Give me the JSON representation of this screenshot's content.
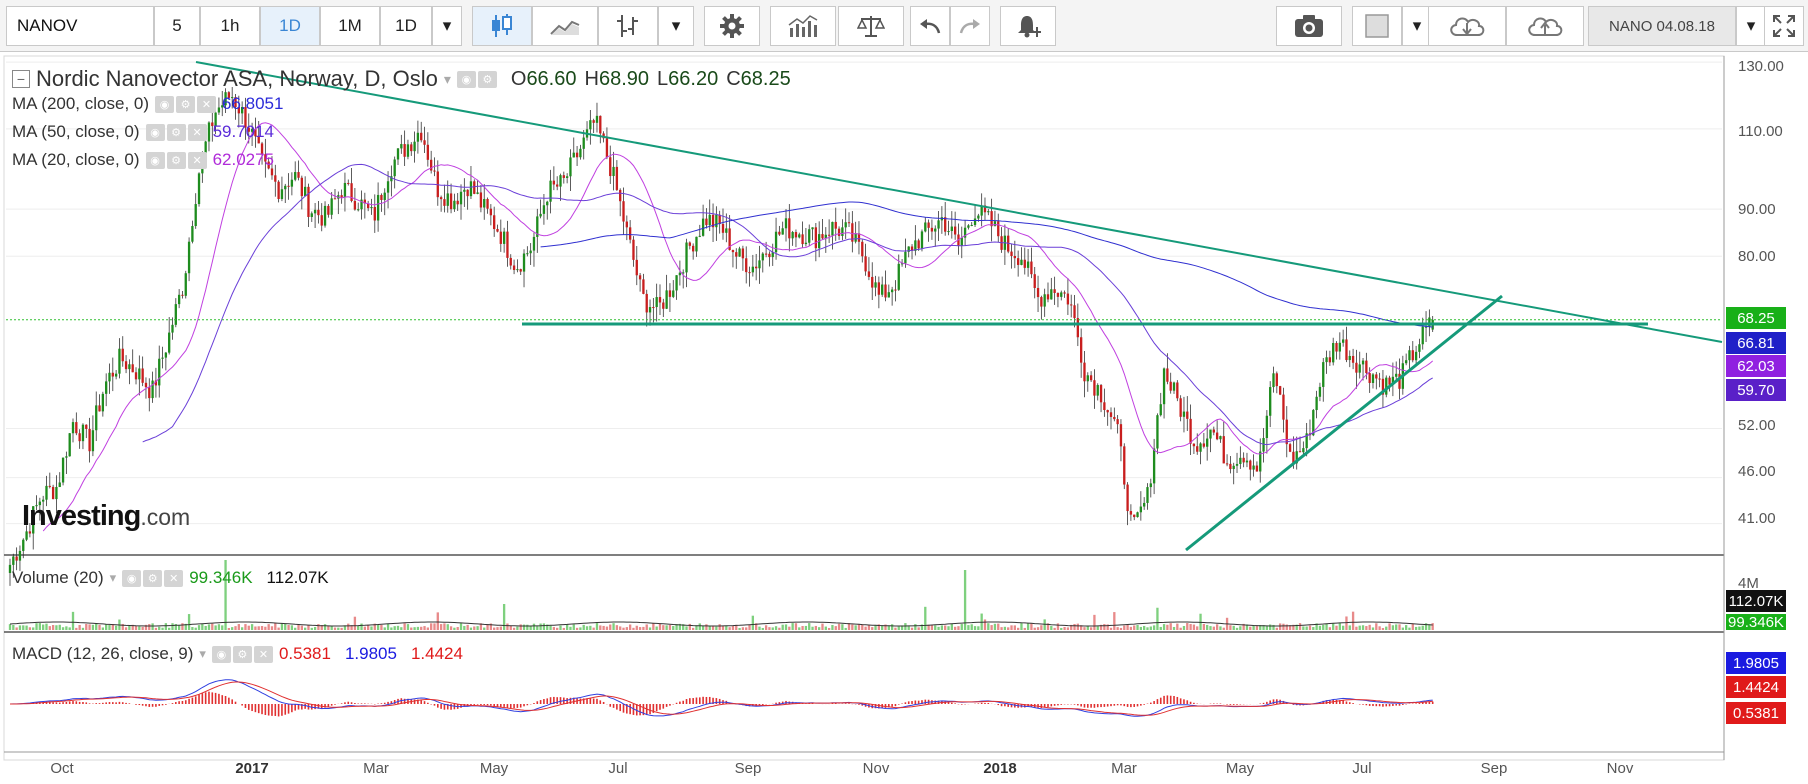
{
  "toolbar": {
    "symbol": "NANOV",
    "intervals": [
      "5",
      "1h",
      "1D",
      "1M",
      "1D"
    ],
    "active_interval": "1D",
    "range_label": "NANO 04.08.18",
    "icons": [
      "candles-icon",
      "line-chart-icon",
      "bar-chart-icon",
      "settings-icon",
      "indicators-icon",
      "compare-scale-icon",
      "undo-icon",
      "redo-icon",
      "alert-icon",
      "camera-icon",
      "color-square-icon",
      "cloud-download-icon",
      "cloud-upload-icon",
      "fullscreen-icon"
    ]
  },
  "main_legend": {
    "title": "Nordic Nanovector ASA, Norway, D, Oslo",
    "open_label": "O",
    "open": "66.60",
    "high_label": "H",
    "high": "68.90",
    "low_label": "L",
    "low": "66.20",
    "close_label": "C",
    "close": "68.25"
  },
  "ma_legends": [
    {
      "label": "MA (200, close, 0)",
      "value": "66.8051",
      "color": "#2b2bd9"
    },
    {
      "label": "MA (50, close, 0)",
      "value": "59.7014",
      "color": "#5b2bd9"
    },
    {
      "label": "MA (20, close, 0)",
      "value": "62.0275",
      "color": "#b02bd9"
    }
  ],
  "volume_legend": {
    "label": "Volume (20)",
    "v1": "99.346K",
    "v2": "112.07K"
  },
  "macd_legend": {
    "label": "MACD (12, 26, close, 9)",
    "v1": "0.5381",
    "v2": "1.9805",
    "v3": "1.4424"
  },
  "price_axis": [
    "130.00",
    "110.00",
    "90.00",
    "80.00",
    "52.00",
    "46.00",
    "41.00"
  ],
  "price_tags": [
    {
      "value": "68.25",
      "color": "#18b018"
    },
    {
      "value": "66.81",
      "color": "#2020c8"
    },
    {
      "value": "62.03",
      "color": "#9020e0"
    },
    {
      "value": "59.70",
      "color": "#5a20c8"
    }
  ],
  "volume_axis": {
    "label": "4M",
    "tag1": "112.07K",
    "tag2": "99.346K"
  },
  "macd_tags": [
    {
      "value": "1.9805",
      "color": "#1a1ae0"
    },
    {
      "value": "1.4424",
      "color": "#e01a1a"
    },
    {
      "value": "0.5381",
      "color": "#e01a1a"
    }
  ],
  "time_axis": [
    {
      "label": "Oct",
      "bold": false
    },
    {
      "label": "2017",
      "bold": true
    },
    {
      "label": "Mar",
      "bold": false
    },
    {
      "label": "May",
      "bold": false
    },
    {
      "label": "Jul",
      "bold": false
    },
    {
      "label": "Sep",
      "bold": false
    },
    {
      "label": "Nov",
      "bold": false
    },
    {
      "label": "2018",
      "bold": true
    },
    {
      "label": "Mar",
      "bold": false
    },
    {
      "label": "May",
      "bold": false
    },
    {
      "label": "Jul",
      "bold": false
    },
    {
      "label": "Sep",
      "bold": false
    },
    {
      "label": "Nov",
      "bold": false
    }
  ],
  "watermark": {
    "brand": "Investing",
    "suffix": ".com"
  },
  "colors": {
    "up": "#1e8c1e",
    "down": "#c81e1e",
    "trendline": "#159a7a",
    "grid": "#eeeeee"
  },
  "chart_data": {
    "type": "candlestick",
    "ylim": [
      38,
      132
    ],
    "log_scale": true,
    "key_prices": {
      "open": 66.6,
      "high": 68.9,
      "low": 66.2,
      "close": 68.25
    },
    "approx_closes": [
      37,
      40,
      44,
      45,
      53,
      50,
      58,
      62,
      60,
      57,
      65,
      75,
      100,
      115,
      120,
      112,
      100,
      95,
      98,
      90,
      88,
      95,
      92,
      88,
      100,
      105,
      110,
      95,
      92,
      96,
      90,
      85,
      78,
      82,
      94,
      96,
      104,
      112,
      100,
      85,
      72,
      70,
      75,
      82,
      88,
      86,
      80,
      78,
      82,
      86,
      85,
      84,
      86,
      85,
      80,
      72,
      75,
      82,
      85,
      88,
      82,
      90,
      87,
      82,
      80,
      72,
      74,
      72,
      60,
      57,
      52,
      40,
      44,
      60,
      55,
      50,
      52,
      48,
      49,
      47,
      60,
      48,
      50,
      60,
      65,
      62,
      60,
      58,
      59,
      64,
      68
    ]
  }
}
